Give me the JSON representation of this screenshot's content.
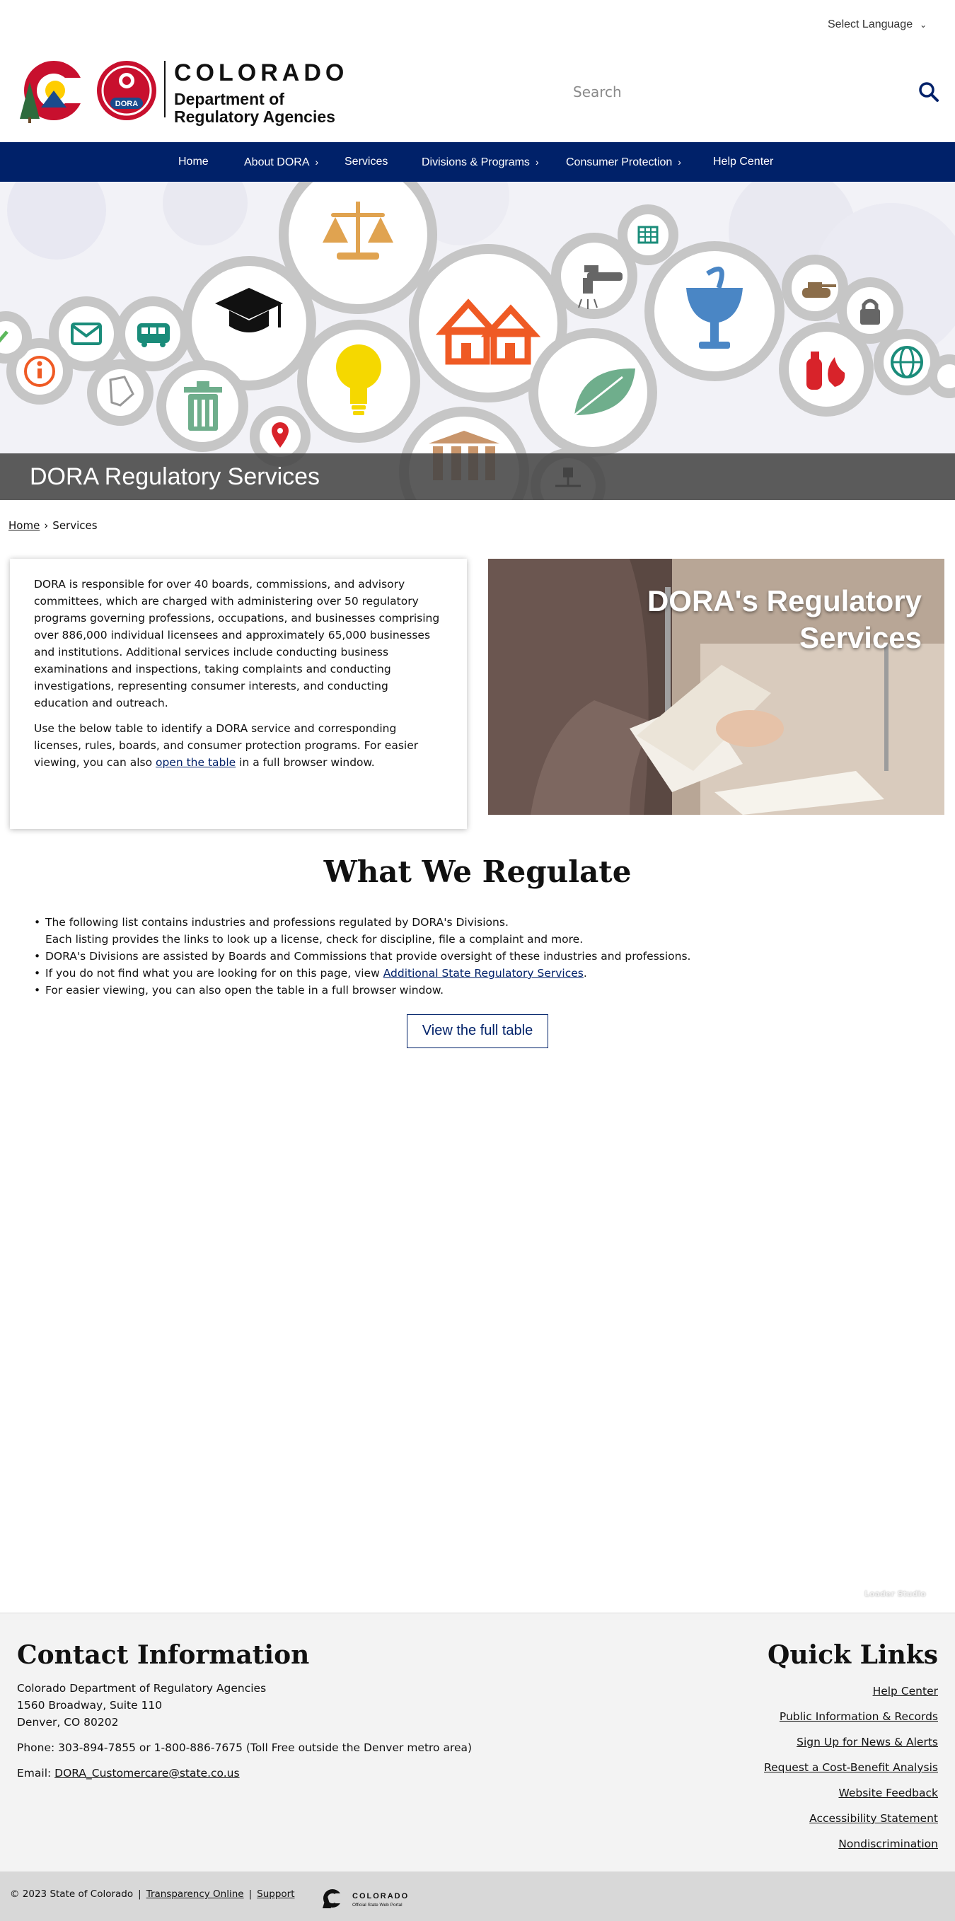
{
  "header": {
    "language_select": "Select Language",
    "logo": {
      "line1": "COLORADO",
      "line2": "Department of",
      "line3": "Regulatory Agencies",
      "badge_text": "DORA"
    },
    "search_placeholder": "Search"
  },
  "nav": {
    "items": [
      {
        "label": "Home"
      },
      {
        "label": "About DORA"
      },
      {
        "label": "Services"
      },
      {
        "label": "Divisions & Programs"
      },
      {
        "label": "Consumer Protection"
      },
      {
        "label": "Help Center"
      }
    ]
  },
  "hero": {
    "title": "DORA Regulatory Services"
  },
  "breadcrumb": {
    "home": "Home",
    "separator": "›",
    "current": "Services"
  },
  "intro": {
    "paragraph1": "DORA is responsible for over 40 boards, commissions, and advisory committees, which are charged with administering over 50 regulatory programs governing professions, occupations, and businesses comprising over 886,000 individual licensees and approximately 65,000 businesses and institutions. Additional services include conducting business examinations and inspections, taking complaints and conducting investigations, representing consumer interests, and conducting education and outreach.",
    "paragraph2_before": "Use the below table to identify a DORA service and corresponding licenses, rules, boards, and consumer protection programs. For easier viewing, you can also ",
    "paragraph2_link": "open the table",
    "paragraph2_after": " in a full browser window."
  },
  "photo_panel": {
    "title": "DORA's Regulatory Services"
  },
  "regulate": {
    "title": "What We Regulate",
    "items": [
      "The following list contains industries and professions regulated by DORA's Divisions.",
      "Each listing provides the links to look up a license, check for discipline, file a complaint and more.",
      "DORA's Divisions are assisted by Boards and Commissions that provide oversight of these industries and professions.",
      "If you do not find what you are looking for on this page, view ",
      "For easier viewing, you can also open the table in a full browser window."
    ],
    "link_text": "Additional State Regulatory Services",
    "link_suffix": ".",
    "button_label": "View the full table"
  },
  "credit": "Loader Studio",
  "footer": {
    "contact_title": "Contact Information",
    "org": "Colorado Department of Regulatory Agencies",
    "street": "1560 Broadway, Suite 110",
    "city": "Denver, CO 80202",
    "phone": "Phone: 303-894-7855 or 1-800-886-7675 (Toll Free outside the Denver metro area)",
    "email_label": "Email: ",
    "email": "DORA_Customercare@state.co.us",
    "quick_title": "Quick Links",
    "quick_links": [
      "Help Center",
      "Public Information & Records",
      "Sign Up for News & Alerts",
      "Request a Cost-Benefit Analysis",
      "Website Feedback",
      "Accessibility Statement",
      "Nondiscrimination"
    ],
    "copyright": "© 2023 State of Colorado",
    "bottom_links": [
      "Transparency Online",
      "Support"
    ],
    "portal_name": "COLORADO",
    "portal_sub": "Official State Web Portal"
  },
  "colors": {
    "nav_bg": "#002169",
    "accent_blue": "#002169",
    "footer_bg": "#f3f3f3"
  }
}
